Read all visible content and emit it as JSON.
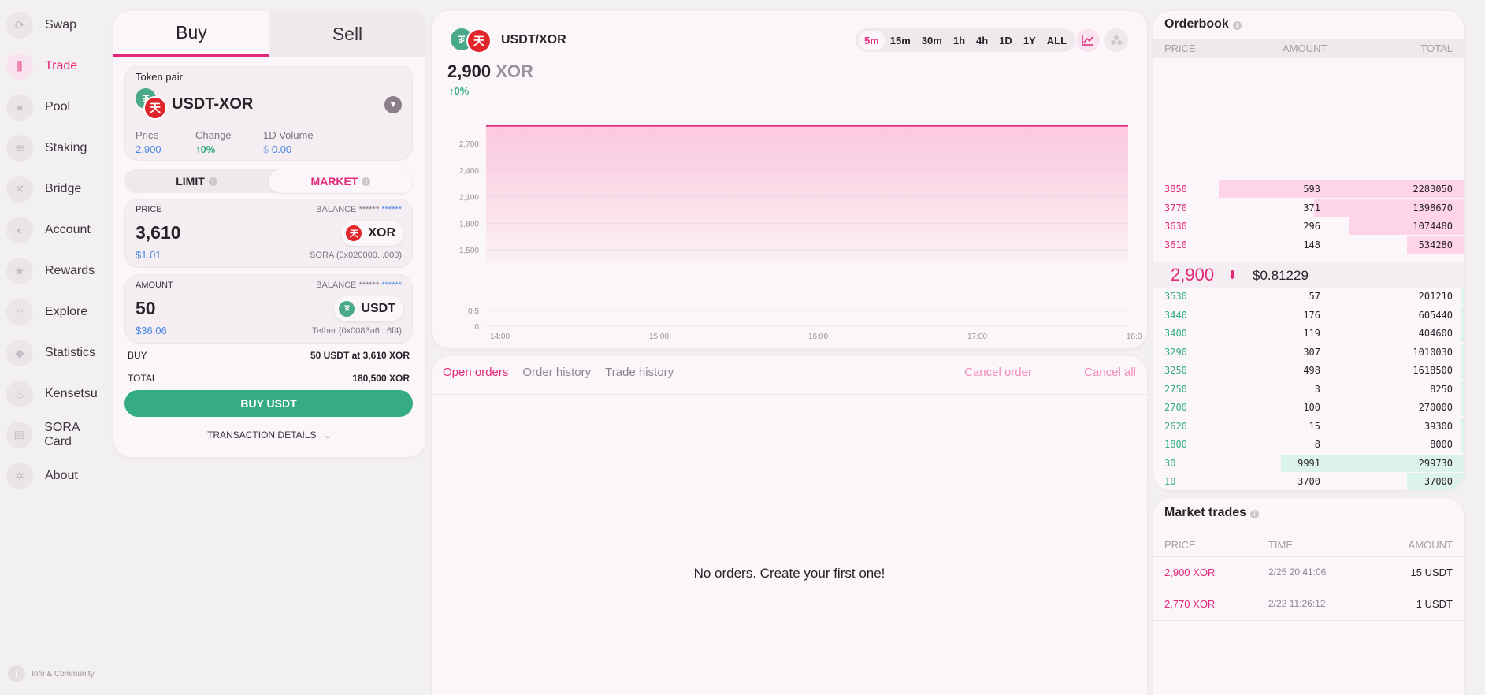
{
  "sidebar": {
    "items": [
      {
        "label": "Swap",
        "icon": "swap-icon"
      },
      {
        "label": "Trade",
        "icon": "trade-icon"
      },
      {
        "label": "Pool",
        "icon": "pool-icon"
      },
      {
        "label": "Staking",
        "icon": "staking-icon"
      },
      {
        "label": "Bridge",
        "icon": "bridge-icon"
      },
      {
        "label": "Account",
        "icon": "account-icon"
      },
      {
        "label": "Rewards",
        "icon": "rewards-icon"
      },
      {
        "label": "Explore",
        "icon": "explore-icon"
      },
      {
        "label": "Statistics",
        "icon": "statistics-icon"
      },
      {
        "label": "Kensetsu",
        "icon": "kensetsu-icon"
      },
      {
        "label": "SORA Card",
        "icon": "card-icon"
      },
      {
        "label": "About",
        "icon": "about-icon"
      }
    ],
    "active_index": 1,
    "footer": "Info & Community"
  },
  "trade_form": {
    "tabs": {
      "buy": "Buy",
      "sell": "Sell"
    },
    "pair_label": "Token pair",
    "pair_name": "USDT-XOR",
    "stats": {
      "price_label": "Price",
      "price_value": "2,900",
      "change_label": "Change",
      "change_value": "0%",
      "volume_label": "1D Volume",
      "volume_currency": "$",
      "volume_value": "0.00"
    },
    "order_types": {
      "limit": "LIMIT",
      "market": "MARKET"
    },
    "price_input": {
      "label": "PRICE",
      "balance_label": "BALANCE",
      "balance_mask": "******",
      "balance_value": "******",
      "value": "3,610",
      "fiat": "$1.01",
      "token": "XOR",
      "token_addr": "SORA (0x020000...000)"
    },
    "amount_input": {
      "label": "AMOUNT",
      "balance_label": "BALANCE",
      "balance_mask": "******",
      "balance_value": "******",
      "value": "50",
      "fiat": "$36.06",
      "token": "USDT",
      "token_addr": "Tether (0x0083a6...6f4)"
    },
    "summary": {
      "buy_label": "BUY",
      "buy_value": "50 USDT at 3,610 XOR",
      "total_label": "TOTAL",
      "total_value": "180,500 XOR"
    },
    "submit_label": "BUY USDT",
    "details_label": "TRANSACTION DETAILS"
  },
  "chart_panel": {
    "pair": "USDT/XOR",
    "price": "2,900",
    "price_unit": "XOR",
    "change": "0%",
    "intervals": [
      "5m",
      "15m",
      "30m",
      "1h",
      "4h",
      "1D",
      "1Y",
      "ALL"
    ],
    "active_interval": "5m"
  },
  "chart_data": {
    "type": "area",
    "x": [
      "14:00",
      "15:00",
      "16:00",
      "17:00",
      "18:0"
    ],
    "series": [
      {
        "values": [
          2900,
          2900,
          2900,
          2900,
          2900
        ]
      }
    ],
    "price_ticks": [
      "1,500",
      "1,800",
      "2,100",
      "2,400",
      "2,700"
    ],
    "volume_ticks": [
      "0",
      "0.5"
    ],
    "ylim": [
      1350,
      2950
    ],
    "line_color": "#e2287a",
    "fill_color": "#fbc6dc"
  },
  "orders": {
    "tabs": [
      "Open orders",
      "Order history",
      "Trade history"
    ],
    "active_tab": 0,
    "cancel_order": "Cancel order",
    "cancel_all": "Cancel all",
    "empty_text": "No orders. Create your first one!"
  },
  "orderbook": {
    "title": "Orderbook",
    "headers": {
      "price": "PRICE",
      "amount": "AMOUNT",
      "total": "TOTAL"
    },
    "asks": [
      {
        "price": "3850",
        "amount": "593",
        "total": "2283050",
        "depth": 1.0
      },
      {
        "price": "3770",
        "amount": "371",
        "total": "1398670",
        "depth": 0.61
      },
      {
        "price": "3630",
        "amount": "296",
        "total": "1074480",
        "depth": 0.47
      },
      {
        "price": "3610",
        "amount": "148",
        "total": "534280",
        "depth": 0.23
      }
    ],
    "mid_price": "2,900",
    "mid_fiat": "$0.81229",
    "bids": [
      {
        "price": "3530",
        "amount": "57",
        "total": "201210",
        "depth": 0.012
      },
      {
        "price": "3440",
        "amount": "176",
        "total": "605440",
        "depth": 0.012
      },
      {
        "price": "3400",
        "amount": "119",
        "total": "404600",
        "depth": 0.012
      },
      {
        "price": "3290",
        "amount": "307",
        "total": "1010030",
        "depth": 0.012
      },
      {
        "price": "3250",
        "amount": "498",
        "total": "1618500",
        "depth": 0.012
      },
      {
        "price": "2750",
        "amount": "3",
        "total": "8250",
        "depth": 0.012
      },
      {
        "price": "2700",
        "amount": "100",
        "total": "270000",
        "depth": 0.012
      },
      {
        "price": "2620",
        "amount": "15",
        "total": "39300",
        "depth": 0.012
      },
      {
        "price": "1800",
        "amount": "8",
        "total": "8000",
        "depth": 0.012
      },
      {
        "price": "30",
        "amount": "9991",
        "total": "299730",
        "depth": 1.0
      },
      {
        "price": "10",
        "amount": "3700",
        "total": "37000",
        "depth": 0.31
      }
    ],
    "ask_color": "#fdd5e6",
    "bid_color": "#dcf3ea"
  },
  "market_trades": {
    "title": "Market trades",
    "headers": {
      "price": "PRICE",
      "time": "TIME",
      "amount": "AMOUNT"
    },
    "rows": [
      {
        "price": "2,900 XOR",
        "time": "2/25 20:41:06",
        "amount": "15 USDT"
      },
      {
        "price": "2,770 XOR",
        "time": "2/22 11:26:12",
        "amount": "1 USDT"
      }
    ]
  }
}
